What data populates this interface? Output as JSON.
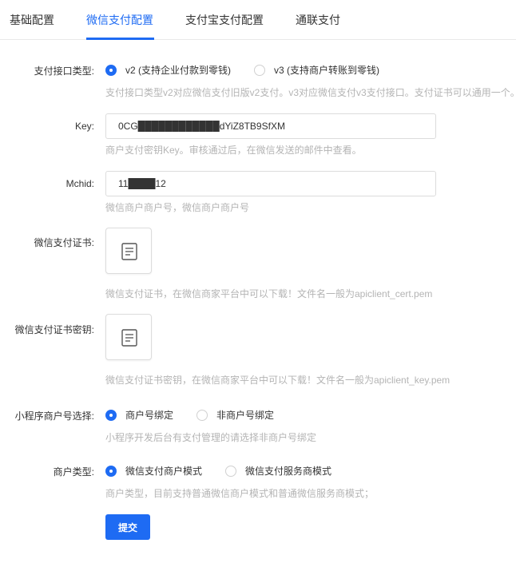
{
  "tabs": [
    {
      "label": "基础配置",
      "active": false
    },
    {
      "label": "微信支付配置",
      "active": true
    },
    {
      "label": "支付宝支付配置",
      "active": false
    },
    {
      "label": "通联支付",
      "active": false
    }
  ],
  "colors": {
    "accent": "#1e6bf3",
    "hint": "#b4b4b4",
    "border": "#dcdcdc"
  },
  "form": {
    "api_type": {
      "label": "支付接口类型:",
      "options": [
        {
          "label": "v2 (支持企业付款到零钱)",
          "checked": true
        },
        {
          "label": "v3 (支持商户转账到零钱)",
          "checked": false
        }
      ],
      "hint": "支付接口类型v2对应微信支付旧版v2支付。v3对应微信支付v3支付接口。支付证书可以通用一个。"
    },
    "key": {
      "label": "Key:",
      "value": "0CG████████████dYiZ8TB9SfXM",
      "hint": "商户支付密钥Key。审核通过后，在微信发送的邮件中查看。"
    },
    "mchid": {
      "label": "Mchid:",
      "value": "11████12",
      "hint": "微信商户商户号，微信商户商户号"
    },
    "cert": {
      "label": "微信支付证书:",
      "icon": "document-icon",
      "hint": "微信支付证书，在微信商家平台中可以下载！文件名一般为apiclient_cert.pem"
    },
    "cert_key": {
      "label": "微信支付证书密钥:",
      "icon": "document-icon",
      "hint": "微信支付证书密钥，在微信商家平台中可以下载！文件名一般为apiclient_key.pem"
    },
    "miniapp_bind": {
      "label": "小程序商户号选择:",
      "options": [
        {
          "label": "商户号绑定",
          "checked": true
        },
        {
          "label": "非商户号绑定",
          "checked": false
        }
      ],
      "hint": "小程序开发后台有支付管理的请选择非商户号绑定"
    },
    "merchant_type": {
      "label": "商户类型:",
      "options": [
        {
          "label": "微信支付商户模式",
          "checked": true
        },
        {
          "label": "微信支付服务商模式",
          "checked": false
        }
      ],
      "hint": "商户类型，目前支持普通微信商户模式和普通微信服务商模式；"
    },
    "submit_label": "提交"
  }
}
